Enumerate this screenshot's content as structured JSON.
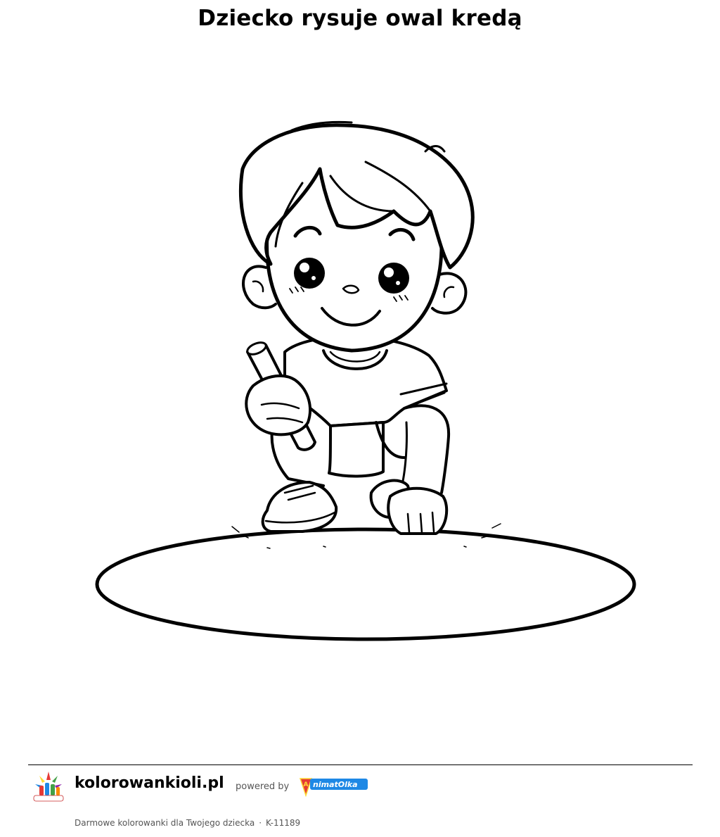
{
  "page": {
    "title": "Dziecko rysuje owal kredą"
  },
  "illustration": {
    "subject": "child-drawing-oval-with-chalk"
  },
  "footer": {
    "site_name": "kolorowankioli.pl",
    "powered_by": "powered by",
    "partner_logo_text": "AnimatOlka",
    "logo_text": "KolorowankiOli",
    "tagline": "Darmowe kolorowanki dla Twojego dziecka",
    "separator": "·",
    "code": "K-11189"
  },
  "colors": {
    "line": "#000000",
    "partner_blue": "#1e88e5",
    "partner_red": "#e53935",
    "partner_yellow": "#fdd835"
  }
}
